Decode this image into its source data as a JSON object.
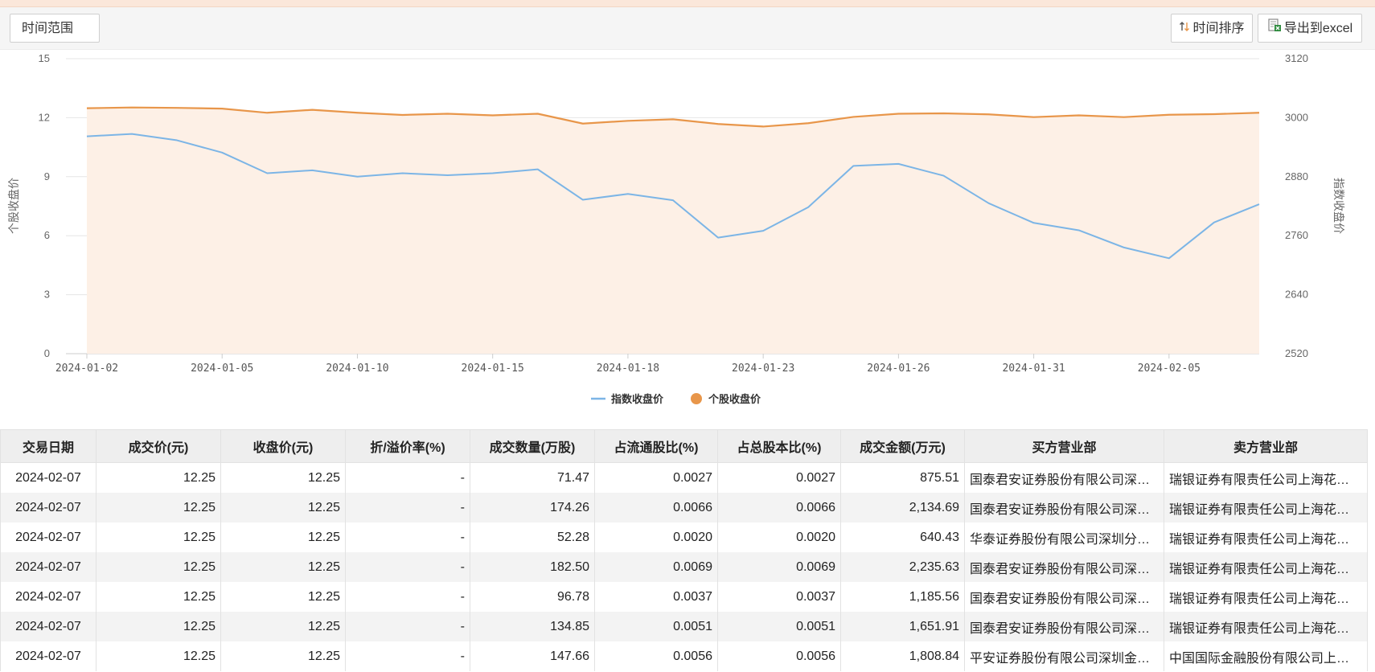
{
  "toolbar": {
    "range_label": "时间范围",
    "sort_label": "时间排序",
    "export_label": "导出到excel"
  },
  "chart_data": {
    "type": "line",
    "x": [
      "2024-01-02",
      "2024-01-03",
      "2024-01-04",
      "2024-01-05",
      "2024-01-08",
      "2024-01-09",
      "2024-01-10",
      "2024-01-11",
      "2024-01-12",
      "2024-01-15",
      "2024-01-16",
      "2024-01-17",
      "2024-01-18",
      "2024-01-19",
      "2024-01-22",
      "2024-01-23",
      "2024-01-24",
      "2024-01-25",
      "2024-01-26",
      "2024-01-29",
      "2024-01-30",
      "2024-01-31",
      "2024-02-01",
      "2024-02-02",
      "2024-02-05",
      "2024-02-06",
      "2024-02-07"
    ],
    "x_ticks": [
      "2024-01-02",
      "2024-01-05",
      "2024-01-10",
      "2024-01-15",
      "2024-01-18",
      "2024-01-23",
      "2024-01-26",
      "2024-01-31",
      "2024-02-05"
    ],
    "series": [
      {
        "name": "指数收盘价",
        "axis": "right",
        "color": "#7cb5e6",
        "values": [
          2962,
          2967,
          2954,
          2929,
          2887,
          2893,
          2880,
          2887,
          2883,
          2887,
          2895,
          2833,
          2845,
          2832,
          2756,
          2770,
          2818,
          2902,
          2906,
          2882,
          2826,
          2786,
          2771,
          2736,
          2714,
          2787,
          2824
        ]
      },
      {
        "name": "个股收盘价",
        "axis": "left",
        "color": "#e8964a",
        "area_color": "#fdf0e6",
        "values": [
          12.48,
          12.52,
          12.5,
          12.46,
          12.25,
          12.4,
          12.25,
          12.14,
          12.2,
          12.12,
          12.2,
          11.7,
          11.84,
          11.92,
          11.68,
          11.55,
          11.72,
          12.04,
          12.2,
          12.22,
          12.17,
          12.03,
          12.12,
          12.03,
          12.15,
          12.18,
          12.25
        ]
      }
    ],
    "left_axis": {
      "label": "个股收盘价",
      "ylim": [
        0,
        15
      ],
      "ticks": [
        0,
        3,
        6,
        9,
        12,
        15
      ]
    },
    "right_axis": {
      "label": "指数收盘价",
      "ylim": [
        2520,
        3120
      ],
      "ticks": [
        2520,
        2640,
        2760,
        2880,
        3000,
        3120
      ]
    },
    "legend_position": "bottom-center",
    "grid": true
  },
  "table": {
    "headers": [
      "交易日期",
      "成交价(元)",
      "收盘价(元)",
      "折/溢价率(%)",
      "成交数量(万股)",
      "占流通股比(%)",
      "占总股本比(%)",
      "成交金额(万元)",
      "买方营业部",
      "卖方营业部"
    ],
    "rows": [
      [
        "2024-02-07",
        "12.25",
        "12.25",
        "-",
        "71.47",
        "0.0027",
        "0.0027",
        "875.51",
        "国泰君安证券股份有限公司深圳分公司",
        "瑞银证券有限责任公司上海花园石桥路证券营业部"
      ],
      [
        "2024-02-07",
        "12.25",
        "12.25",
        "-",
        "174.26",
        "0.0066",
        "0.0066",
        "2,134.69",
        "国泰君安证券股份有限公司深圳分公司",
        "瑞银证券有限责任公司上海花园石桥路证券营业部"
      ],
      [
        "2024-02-07",
        "12.25",
        "12.25",
        "-",
        "52.28",
        "0.0020",
        "0.0020",
        "640.43",
        "华泰证券股份有限公司深圳分公司",
        "瑞银证券有限责任公司上海花园石桥路证券营业部"
      ],
      [
        "2024-02-07",
        "12.25",
        "12.25",
        "-",
        "182.50",
        "0.0069",
        "0.0069",
        "2,235.63",
        "国泰君安证券股份有限公司深圳分公司",
        "瑞银证券有限责任公司上海花园石桥路证券营业部"
      ],
      [
        "2024-02-07",
        "12.25",
        "12.25",
        "-",
        "96.78",
        "0.0037",
        "0.0037",
        "1,185.56",
        "国泰君安证券股份有限公司深圳分公司",
        "瑞银证券有限责任公司上海花园石桥路证券营业部"
      ],
      [
        "2024-02-07",
        "12.25",
        "12.25",
        "-",
        "134.85",
        "0.0051",
        "0.0051",
        "1,651.91",
        "国泰君安证券股份有限公司深圳分公司",
        "瑞银证券有限责任公司上海花园石桥路证券营业部"
      ],
      [
        "2024-02-07",
        "12.25",
        "12.25",
        "-",
        "147.66",
        "0.0056",
        "0.0056",
        "1,808.84",
        "平安证券股份有限公司深圳金田路证券营业部",
        "中国国际金融股份有限公司上海分公司"
      ]
    ]
  }
}
